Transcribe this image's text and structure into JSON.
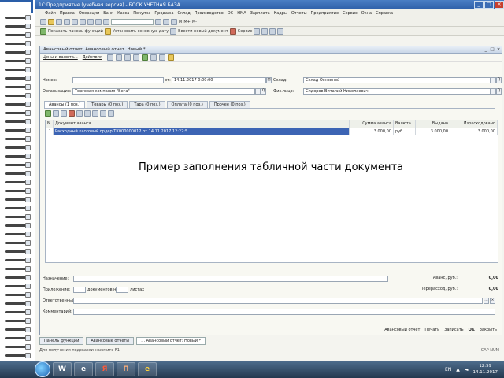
{
  "window": {
    "title": "1С:Предприятие (учебная версия) - БОСК УЧЕТНАЯ БАЗА"
  },
  "menu": [
    "Файл",
    "Правка",
    "Операции",
    "Банк",
    "Касса",
    "Покупка",
    "Продажа",
    "Склад",
    "Производство",
    "ОС",
    "НМА",
    "Зарплата",
    "Кадры",
    "Отчеты",
    "Предприятие",
    "Сервис",
    "Окна",
    "Справка"
  ],
  "toolbar": {
    "btn_labels": [
      "Показать панель функций",
      "Установить основную дату",
      "Ввести новый документ",
      "Сервис"
    ],
    "extra": [
      "М",
      "М+",
      "М-"
    ]
  },
  "doc": {
    "title": "Авансовый отчет: Авансовый отчет. Новый *",
    "actions": [
      "Цены и валюта...",
      "Действия"
    ],
    "number_label": "Номер:",
    "number_value": "",
    "from_label": "от:",
    "date_value": "14.11.2017 0:00:00",
    "warehouse_label": "Склад:",
    "warehouse_value": "Склад Основной",
    "org_label": "Организация:",
    "org_value": "Торговая компания \"Вега\"",
    "person_label": "Физ.лицо:",
    "person_value": "Сидоров Виталий Николаевич",
    "tabs": [
      "Авансы (1 поз.)",
      "Товары (0 поз.)",
      "Тара (0 поз.)",
      "Оплата (0 поз.)",
      "Прочее (0 поз.)"
    ],
    "grid": {
      "columns": [
        "N",
        "Документ аванса",
        "Сумма аванса",
        "Валюта",
        "Выдано",
        "Израсходовано"
      ],
      "rows": [
        {
          "n": "1",
          "doc": "Расходный кассовый ордер ТК000000012 от 14.11.2017 12:22:5",
          "amount": "3 000,00",
          "currency": "руб",
          "issued": "3 000,00",
          "spent": "3 000,00"
        }
      ]
    },
    "caption": "Пример заполнения табличной части документа",
    "purpose_label": "Назначение:",
    "attach_label": "Приложение:",
    "attach_docs": "документов на",
    "attach_sheets": "листах",
    "responsible_label": "Ответственный:",
    "comment_label": "Комментарий:",
    "advance_label": "Аванс, руб.:",
    "advance_value": "0,00",
    "overspend_label": "Перерасход, руб.:",
    "overspend_value": "0,00",
    "bottom": {
      "report": "Авансовый отчет",
      "print": "Печать",
      "write": "Записать",
      "ok": "OK",
      "close": "Закрыть"
    }
  },
  "window_tabs": [
    "Панель функций",
    "Авансовые отчеты",
    "... Авансовый отчет: Новый *"
  ],
  "hint": "Для получения подсказки нажмите F1",
  "caps": "CAP  NUM",
  "taskbar": {
    "apps": [
      "W",
      "e",
      "Я",
      "П",
      "е"
    ],
    "lang": "EN",
    "time": "12:59",
    "date": "14.11.2017"
  }
}
